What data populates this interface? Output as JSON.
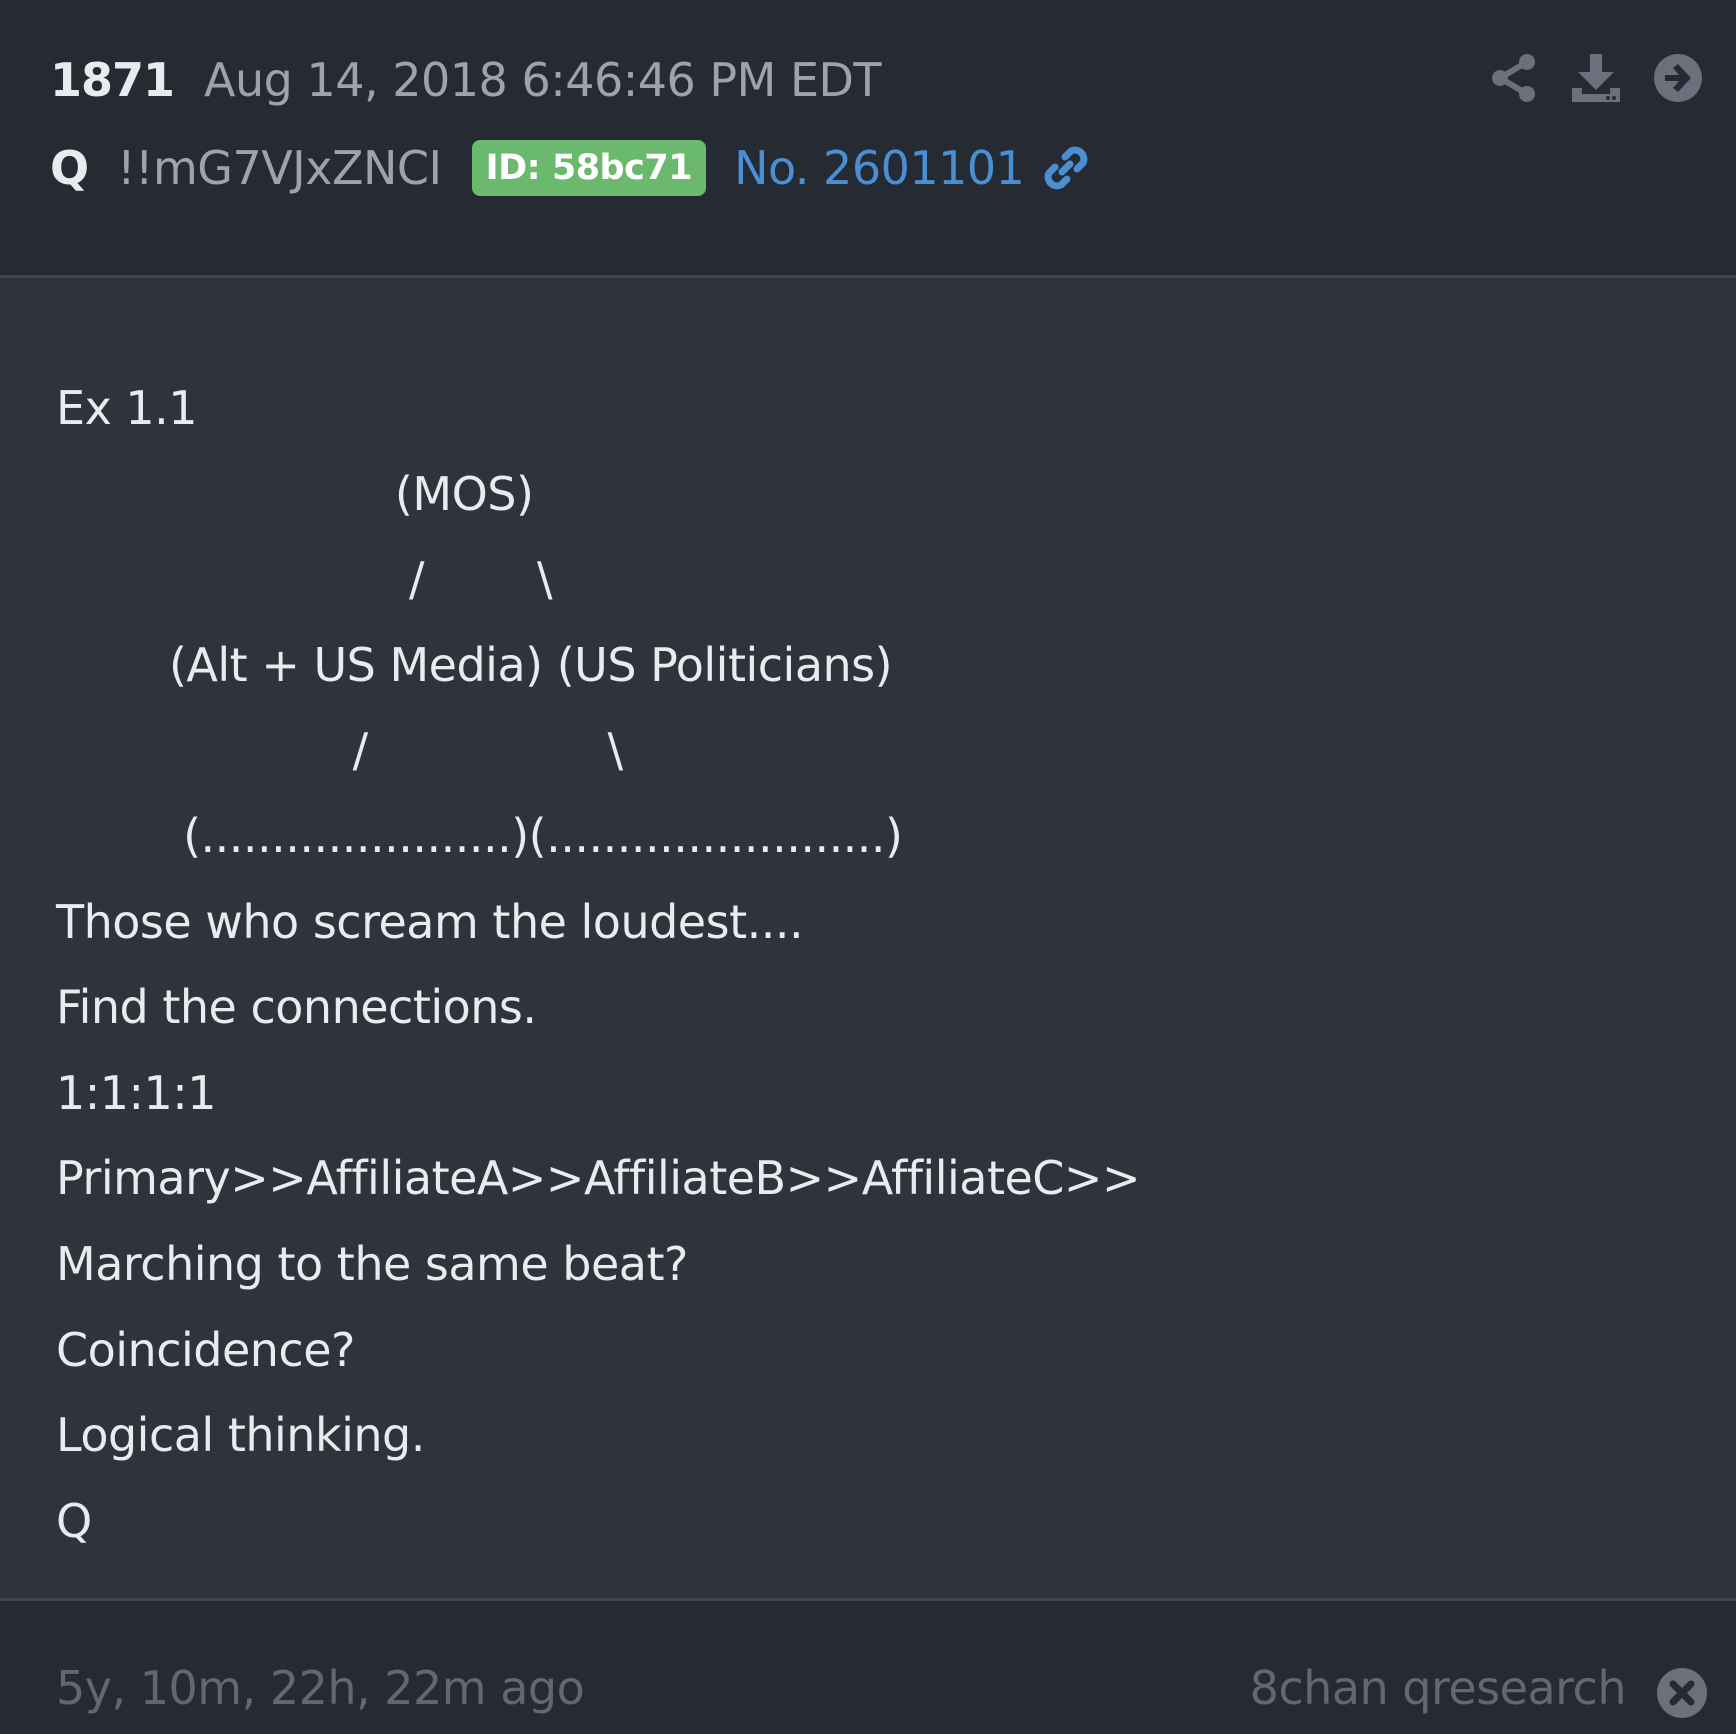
{
  "header": {
    "post_number": "1871",
    "timestamp": "Aug 14, 2018 6:46:46 PM EDT",
    "author": "Q",
    "tripcode": "!!mG7VJxZNCI",
    "id_badge": "ID: 58bc71",
    "post_link": "No. 2601101",
    "actions": [
      "share-icon",
      "download-icon",
      "arrow-right-circle-icon"
    ]
  },
  "body": {
    "lines": [
      "Ex 1.1",
      "                        (MOS)",
      "                         /        \\",
      "        (Alt + US Media) (US Politicians)",
      "                     /                 \\",
      "         (......................)(........................)",
      "Those who scream the loudest....",
      "Find the connections.",
      "1:1:1:1",
      "Primary>>AffiliateA>>AffiliateB>>AffiliateC>>",
      "Marching to the same beat?",
      "Coincidence?",
      "Logical thinking.",
      "Q"
    ]
  },
  "footer": {
    "time_ago": "5y, 10m, 22h, 22m ago",
    "source": "8chan qresearch"
  },
  "colors": {
    "background": "#2e333c",
    "header_background": "#252a33",
    "badge_green": "#6bb96f",
    "link_blue": "#4a8fd1",
    "muted_text": "#9da3ad"
  }
}
